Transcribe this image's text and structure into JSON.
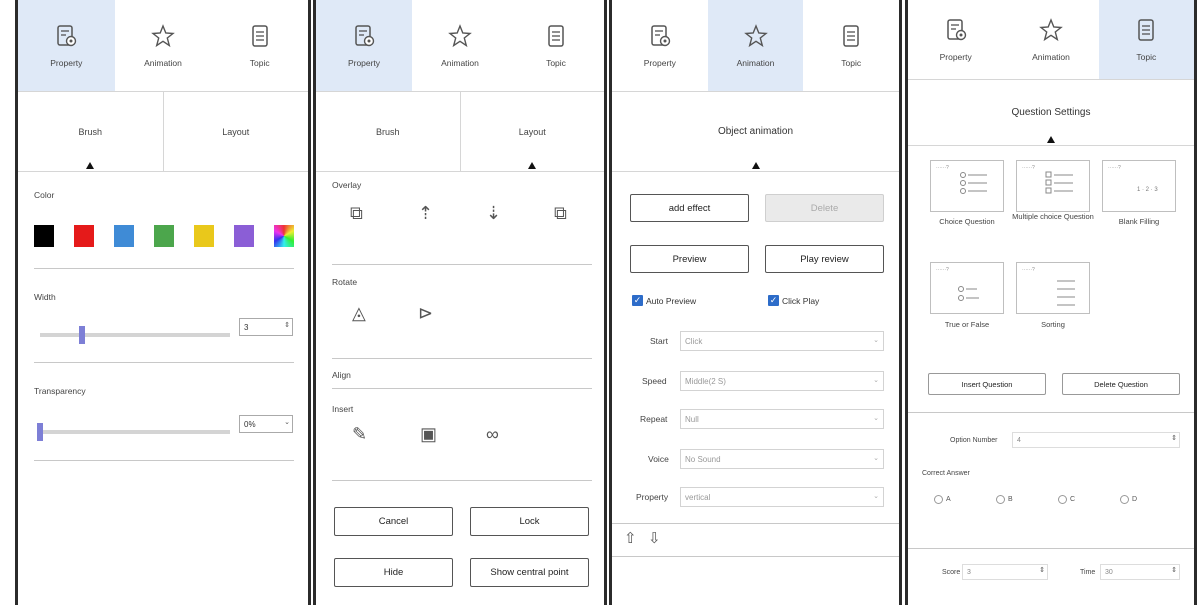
{
  "tabs": {
    "property": "Property",
    "animation": "Animation",
    "topic": "Topic"
  },
  "panel1": {
    "subtabs": {
      "brush": "Brush",
      "layout": "Layout"
    },
    "color_label": "Color",
    "colors": [
      "#000000",
      "#e51a1a",
      "#3f8bd6",
      "#4ca64c",
      "#e9c81b",
      "#8b5ed6",
      "gradient"
    ],
    "width_label": "Width",
    "width_value": "3",
    "transparency_label": "Transparency",
    "transparency_value": "0%"
  },
  "panel2": {
    "subtabs": {
      "brush": "Brush",
      "layout": "Layout"
    },
    "overlay_label": "Overlay",
    "rotate_label": "Rotate",
    "align_label": "Align",
    "insert_label": "Insert",
    "cancel_button": "Cancel",
    "lock_button": "Lock",
    "hide_button": "Hide",
    "show_central_point_button": "Show central point"
  },
  "panel3": {
    "header": "Object animation",
    "add_effect_button": "add effect",
    "delete_button": "Delete",
    "preview_button": "Preview",
    "play_review_button": "Play review",
    "auto_preview_label": "Auto Preview",
    "click_play_label": "Click Play",
    "fields": [
      {
        "label": "Start",
        "value": "Click"
      },
      {
        "label": "Speed",
        "value": "Middle(2 S)"
      },
      {
        "label": "Repeat",
        "value": "Null"
      },
      {
        "label": "Voice",
        "value": "No Sound"
      },
      {
        "label": "Property",
        "value": "vertical"
      }
    ]
  },
  "panel4": {
    "header": "Question Settings",
    "questions": [
      {
        "label": "Choice Question"
      },
      {
        "label": "Multiple choice Question"
      },
      {
        "label": "Blank Filling"
      },
      {
        "label": "True or False"
      },
      {
        "label": "Sorting"
      }
    ],
    "insert_question_button": "Insert Question",
    "delete_question_button": "Delete Question",
    "option_number_label": "Option Number",
    "option_number_value": "4",
    "correct_answer_label": "Correct Answer",
    "answers": [
      "A",
      "B",
      "C",
      "D"
    ],
    "score_label": "Score",
    "score_value": "3",
    "time_label": "Time",
    "time_value": "30"
  }
}
